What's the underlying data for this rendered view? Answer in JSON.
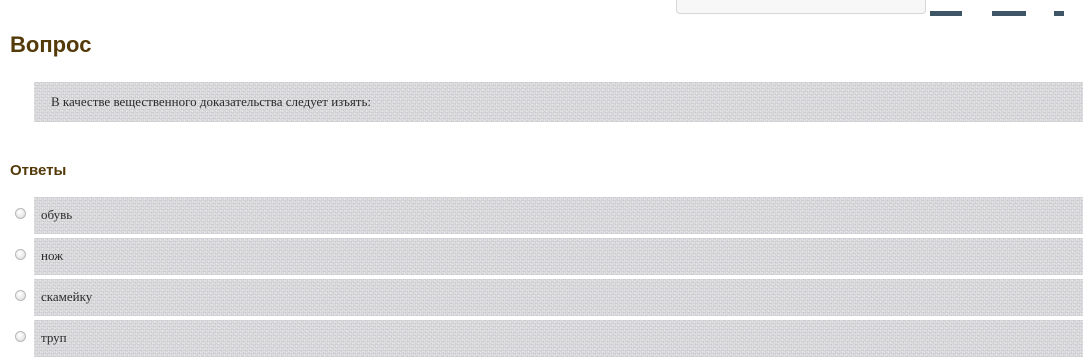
{
  "page": {
    "title": "Вопрос",
    "question_text": "В качестве вещественного доказательства следует изъять:",
    "answers_heading": "Ответы",
    "answers": [
      {
        "label": "обувь"
      },
      {
        "label": "нож"
      },
      {
        "label": "скамейку"
      },
      {
        "label": "труп"
      }
    ]
  },
  "colors": {
    "heading": "#533a08",
    "noise_bg": "#dcdcdc",
    "top_icons": "#3e5566"
  },
  "icons": {
    "top_icons": [
      "toolbar-icon",
      "toolbar-icon",
      "toolbar-icon"
    ],
    "radio": "radio-button"
  }
}
